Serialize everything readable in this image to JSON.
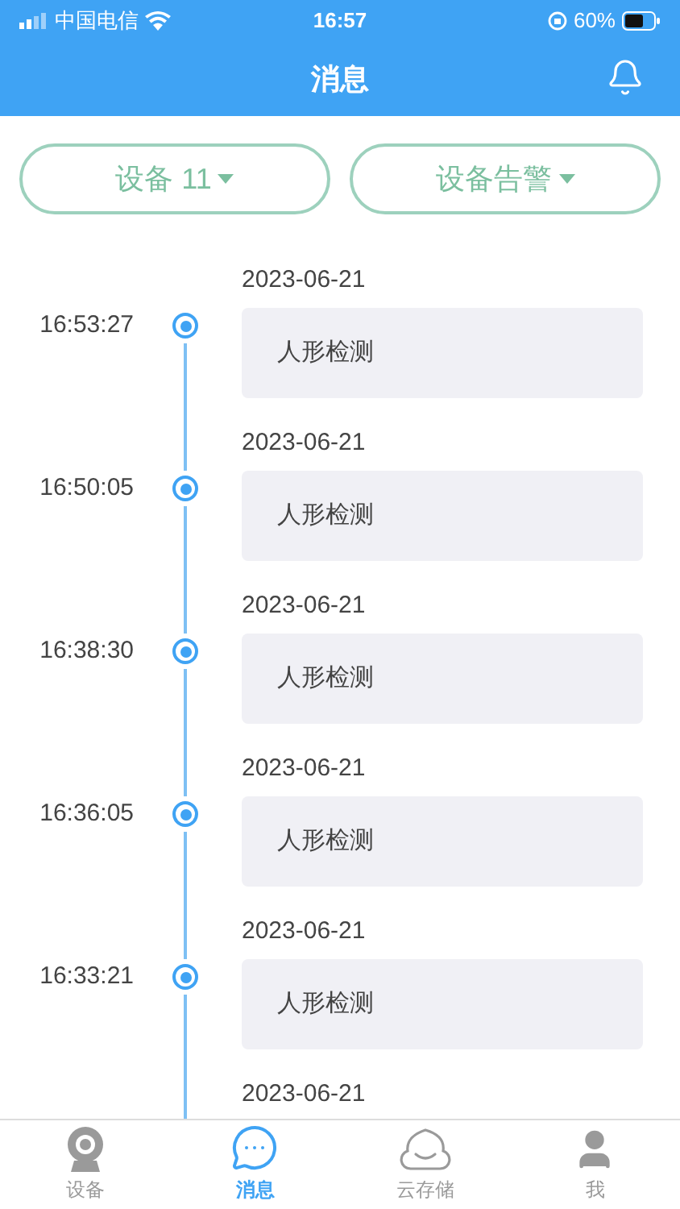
{
  "status_bar": {
    "carrier": "中国电信",
    "time": "16:57",
    "battery": "60%"
  },
  "header": {
    "title": "消息"
  },
  "filters": [
    {
      "label": "设备 11"
    },
    {
      "label": "设备告警"
    }
  ],
  "timeline": [
    {
      "date": "2023-06-21",
      "time": "16:53:27",
      "message": "人形检测"
    },
    {
      "date": "2023-06-21",
      "time": "16:50:05",
      "message": "人形检测"
    },
    {
      "date": "2023-06-21",
      "time": "16:38:30",
      "message": "人形检测"
    },
    {
      "date": "2023-06-21",
      "time": "16:36:05",
      "message": "人形检测"
    },
    {
      "date": "2023-06-21",
      "time": "16:33:21",
      "message": "人形检测"
    },
    {
      "date": "2023-06-21"
    }
  ],
  "tab_bar": [
    {
      "kind": "camera",
      "label": "设备",
      "selected": false
    },
    {
      "kind": "chat",
      "label": "消息",
      "selected": true
    },
    {
      "kind": "cloud",
      "label": "云存储",
      "selected": false
    },
    {
      "kind": "user",
      "label": "我",
      "selected": false
    }
  ]
}
